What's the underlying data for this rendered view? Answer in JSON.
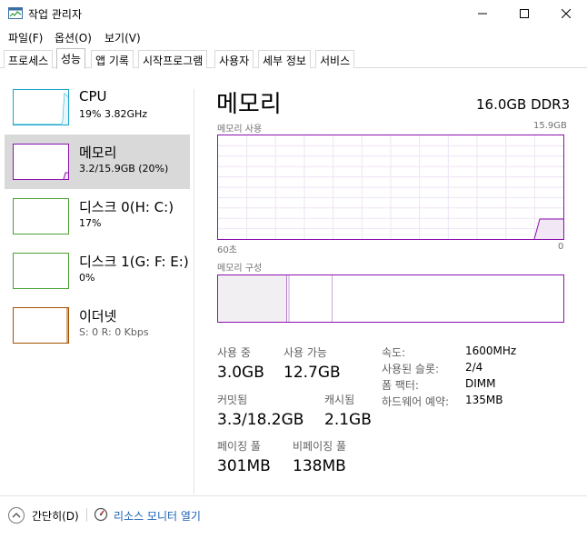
{
  "window": {
    "title": "작업 관리자"
  },
  "menu": {
    "items": [
      "파일(F)",
      "옵션(O)",
      "보기(V)"
    ]
  },
  "tabs": [
    "프로세스",
    "성능",
    "앱 기록",
    "시작프로그램",
    "사용자",
    "세부 정보",
    "서비스"
  ],
  "resources": [
    {
      "name": "CPU",
      "sub": "19% 3.82GHz",
      "color": "#17a5c9",
      "usage": 0.19
    },
    {
      "name": "메모리",
      "sub": "3.2/15.9GB (20%)",
      "color": "#8b12ae",
      "usage": 0.2
    },
    {
      "name": "디스크 0(H: C:)",
      "sub": "17%",
      "color": "#4da033",
      "usage": 0.17
    },
    {
      "name": "디스크 1(G: F: E:)",
      "sub": "0%",
      "color": "#4da033",
      "usage": 0.0
    },
    {
      "name": "이더넷",
      "sub": "S: 0 R: 0 Kbps",
      "color": "#a74f01",
      "usage": 0.0
    }
  ],
  "memory": {
    "title": "메모리",
    "spec": "16.0GB DDR3",
    "usage_label": "메모리 사용",
    "usage_max": "15.9GB",
    "time_left": "60초",
    "time_right": "0",
    "composition_label": "메모리 구성",
    "stats": {
      "in_use_label": "사용 중",
      "in_use_value": "3.0GB",
      "available_label": "사용 가능",
      "available_value": "12.7GB",
      "committed_label": "커밋됨",
      "committed_value": "3.3/18.2GB",
      "cached_label": "캐시됨",
      "cached_value": "2.1GB",
      "paged_label": "페이징 풀",
      "paged_value": "301MB",
      "nonpaged_label": "비페이징 풀",
      "nonpaged_value": "138MB"
    },
    "details": [
      {
        "label": "속도:",
        "value": "1600MHz"
      },
      {
        "label": "사용된 슬롯:",
        "value": "2/4"
      },
      {
        "label": "폼 팩터:",
        "value": "DIMM"
      },
      {
        "label": "하드웨어 예약:",
        "value": "135MB"
      }
    ]
  },
  "footer": {
    "collapse_label": "간단히(D)",
    "monitor_label": "리소스 모니터 열기"
  },
  "colors": {
    "accent_memory": "#8b12ae",
    "accent_cpu": "#17a5c9",
    "accent_disk": "#4da033",
    "accent_ethernet": "#a74f01",
    "link": "#1a5fb4"
  }
}
